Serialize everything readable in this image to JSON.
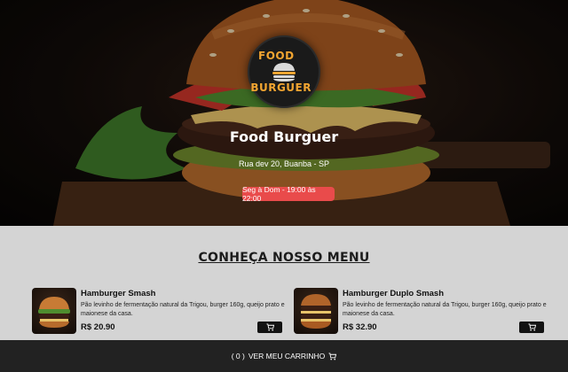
{
  "brand": {
    "logo_top": "FOOD",
    "logo_bottom": "BURGUER",
    "name": "Food Burguer",
    "address": "Rua dev 20, Buanba - SP",
    "hours": "Seg à Dom - 19:00 às 22:00"
  },
  "menu": {
    "title": "CONHEÇA NOSSO MENU",
    "items": [
      {
        "name": "Hamburger Smash",
        "description": "Pão levinho de fermentação natural da Trigou, burger 160g, queijo prato e maionese da casa.",
        "price": "R$ 20.90"
      },
      {
        "name": "Hamburger Duplo Smash",
        "description": "Pão levinho de fermentação natural da Trigou, burger 160g, queijo prato e maionese da casa.",
        "price": "R$ 32.90"
      }
    ]
  },
  "footer": {
    "cart_count_label": "( 0 )",
    "cart_label": "VER MEU CARRINHO"
  },
  "icons": {
    "cart": "cart-icon",
    "logo": "burger-logo-icon"
  },
  "colors": {
    "accent_orange": "#f2a531",
    "badge_red": "#e94b4b",
    "footer_bg": "#222222",
    "page_bg": "#d4d4d4"
  }
}
